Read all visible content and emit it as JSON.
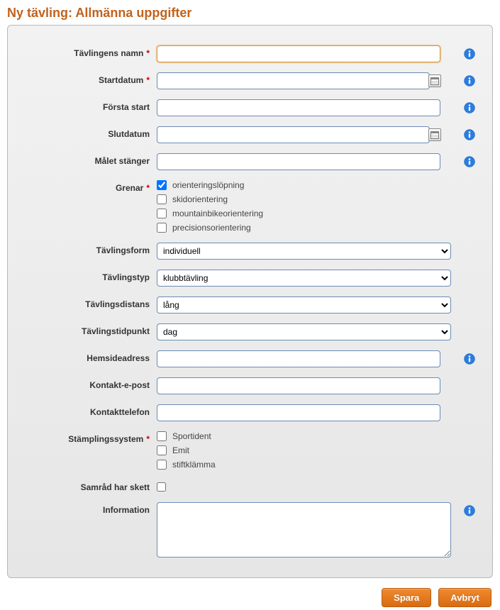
{
  "heading": "Ny tävling: Allmänna uppgifter",
  "labels": {
    "name": "Tävlingens namn",
    "startDate": "Startdatum",
    "firstStart": "Första start",
    "endDate": "Slutdatum",
    "finishClose": "Målet stänger",
    "disciplines": "Grenar",
    "form": "Tävlingsform",
    "type": "Tävlingstyp",
    "distance": "Tävlingsdistans",
    "timeOfDay": "Tävlingstidpunkt",
    "website": "Hemsideadress",
    "email": "Kontakt-e-post",
    "phone": "Kontakttelefon",
    "punching": "Stämplingssystem",
    "consulted": "Samråd har skett",
    "info": "Information"
  },
  "values": {
    "name": "",
    "startDate": "",
    "firstStart": "",
    "endDate": "",
    "finishClose": "",
    "form": "individuell",
    "type": "klubbtävling",
    "distance": "lång",
    "timeOfDay": "dag",
    "website": "",
    "email": "",
    "phone": "",
    "info": ""
  },
  "disciplines": {
    "orienteering": {
      "label": "orienteringslöpning",
      "checked": true
    },
    "ski": {
      "label": "skidorientering",
      "checked": false
    },
    "mtb": {
      "label": "mountainbikeorientering",
      "checked": false
    },
    "precision": {
      "label": "precisionsorientering",
      "checked": false
    }
  },
  "punching": {
    "sportident": {
      "label": "Sportident",
      "checked": false
    },
    "emit": {
      "label": "Emit",
      "checked": false
    },
    "pin": {
      "label": "stiftklämma",
      "checked": false
    }
  },
  "consultedChecked": false,
  "buttons": {
    "save": "Spara",
    "cancel": "Avbryt"
  }
}
